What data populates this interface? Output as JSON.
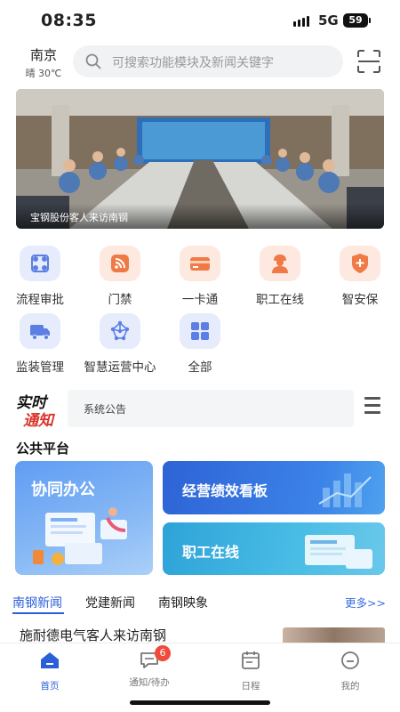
{
  "status_bar": {
    "time": "08:35",
    "network": "5G",
    "battery": "59"
  },
  "header": {
    "city": "南京",
    "weather": "晴 30℃",
    "search_placeholder": "可搜索功能模块及新闻关键字"
  },
  "banner": {
    "caption": "宝钢股份客人来访南钢"
  },
  "functions": [
    {
      "label": "流程审批",
      "icon": "workflow-icon",
      "tone": "blue"
    },
    {
      "label": "门禁",
      "icon": "rss-access-icon",
      "tone": "orange"
    },
    {
      "label": "一卡通",
      "icon": "card-icon",
      "tone": "orange"
    },
    {
      "label": "职工在线",
      "icon": "worker-icon",
      "tone": "orange"
    },
    {
      "label": "智安保",
      "icon": "shield-plus-icon",
      "tone": "orange"
    },
    {
      "label": "监装管理",
      "icon": "truck-icon",
      "tone": "blue"
    },
    {
      "label": "智慧运营中心",
      "icon": "network-icon",
      "tone": "blue"
    },
    {
      "label": "全部",
      "icon": "grid-icon",
      "tone": "blue"
    }
  ],
  "notice": {
    "logo_line1": "实时",
    "logo_line2": "通知",
    "text": "系统公告"
  },
  "public_platform": {
    "title": "公共平台",
    "cards": {
      "collab": "协同办公",
      "performance": "经营绩效看板",
      "workers": "职工在线"
    }
  },
  "news": {
    "tabs": [
      "南钢新闻",
      "党建新闻",
      "南钢映象"
    ],
    "more": "更多>>",
    "first_title": "施耐德电气客人来访南钢"
  },
  "bottom_nav": {
    "items": [
      {
        "label": "首页",
        "icon": "home-icon"
      },
      {
        "label": "通知/待办",
        "icon": "message-icon",
        "badge": "6"
      },
      {
        "label": "日程",
        "icon": "calendar-icon"
      },
      {
        "label": "我的",
        "icon": "profile-icon"
      }
    ]
  },
  "colors": {
    "accent": "#2b5fd9",
    "orange": "#f07a45",
    "badge": "#f04a3a"
  }
}
